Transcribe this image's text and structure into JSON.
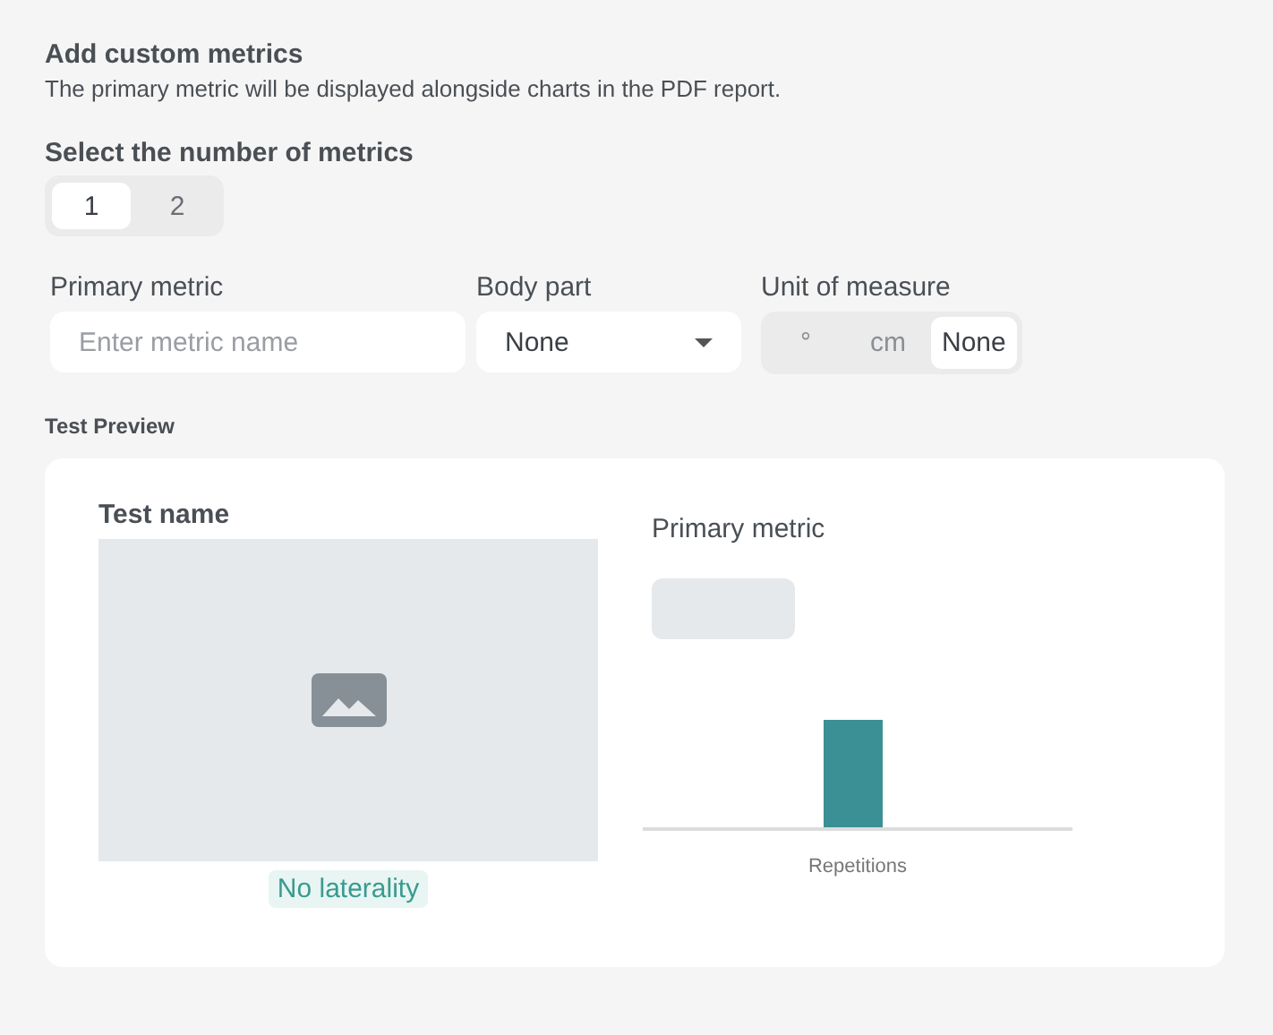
{
  "header": {
    "title": "Add custom metrics",
    "description": "The primary metric will be displayed alongside charts in the PDF report."
  },
  "metric_count": {
    "label": "Select the number of metrics",
    "options": [
      {
        "label": "1",
        "selected": true
      },
      {
        "label": "2",
        "selected": false
      }
    ]
  },
  "fields": {
    "primary_metric": {
      "label": "Primary metric",
      "placeholder": "Enter metric name"
    },
    "body_part": {
      "label": "Body part",
      "value": "None"
    },
    "unit": {
      "label": "Unit of measure",
      "options": [
        {
          "label": "°",
          "selected": false
        },
        {
          "label": "cm",
          "selected": false
        },
        {
          "label": "None",
          "selected": true
        }
      ]
    }
  },
  "preview": {
    "heading": "Test Preview",
    "test_name": "Test name",
    "laterality": "No laterality",
    "metric_label": "Primary metric",
    "chart_label": "Repetitions"
  }
}
